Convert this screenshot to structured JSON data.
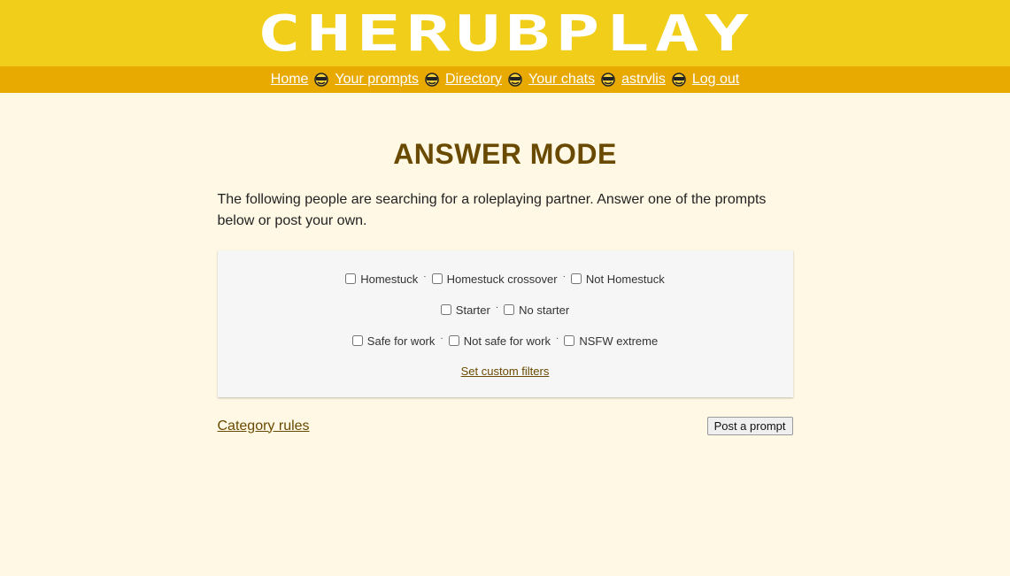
{
  "header": {
    "logo_text": "CHERUBPLAY"
  },
  "nav": {
    "items": [
      {
        "label": "Home"
      },
      {
        "label": "Your prompts"
      },
      {
        "label": "Directory"
      },
      {
        "label": "Your chats"
      },
      {
        "label": "astrvlis"
      },
      {
        "label": "Log out"
      }
    ],
    "separator_icon": "cherub-icon"
  },
  "main": {
    "title": "ANSWER MODE",
    "intro": "The following people are searching for a roleplaying partner. Answer one of the prompts below or post your own."
  },
  "filters": {
    "rows": [
      [
        "Homestuck",
        "Homestuck crossover",
        "Not Homestuck"
      ],
      [
        "Starter",
        "No starter"
      ],
      [
        "Safe for work",
        "Not safe for work",
        "NSFW extreme"
      ]
    ],
    "separator": "·",
    "custom_link": "Set custom filters"
  },
  "footer": {
    "category_rules": "Category rules",
    "post_button": "Post a prompt"
  },
  "colors": {
    "header_bg": "#f1ce19",
    "nav_bg": "#e8a900",
    "page_bg": "#fef8e4",
    "title": "#6a4a00",
    "link": "#6a4a00"
  }
}
